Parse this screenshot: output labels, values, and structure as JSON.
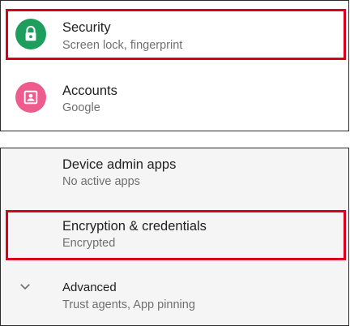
{
  "settings_top": {
    "items": [
      {
        "title": "Security",
        "subtitle": "Screen lock, fingerprint",
        "icon": "lock-icon",
        "icon_bg": "#1e9e5c"
      },
      {
        "title": "Accounts",
        "subtitle": "Google",
        "icon": "account-box-icon",
        "icon_bg": "#ee5c8e"
      }
    ]
  },
  "security_panel": {
    "items": [
      {
        "title": "Device admin apps",
        "subtitle": "No active apps"
      },
      {
        "title": "Encryption & credentials",
        "subtitle": "Encrypted"
      },
      {
        "title": "Advanced",
        "subtitle": "Trust agents, App pinning",
        "icon": "chevron-down-icon"
      }
    ]
  },
  "colors": {
    "highlight": "#d9001b",
    "title_text": "#212121",
    "subtitle_text": "#6f6f6f"
  }
}
